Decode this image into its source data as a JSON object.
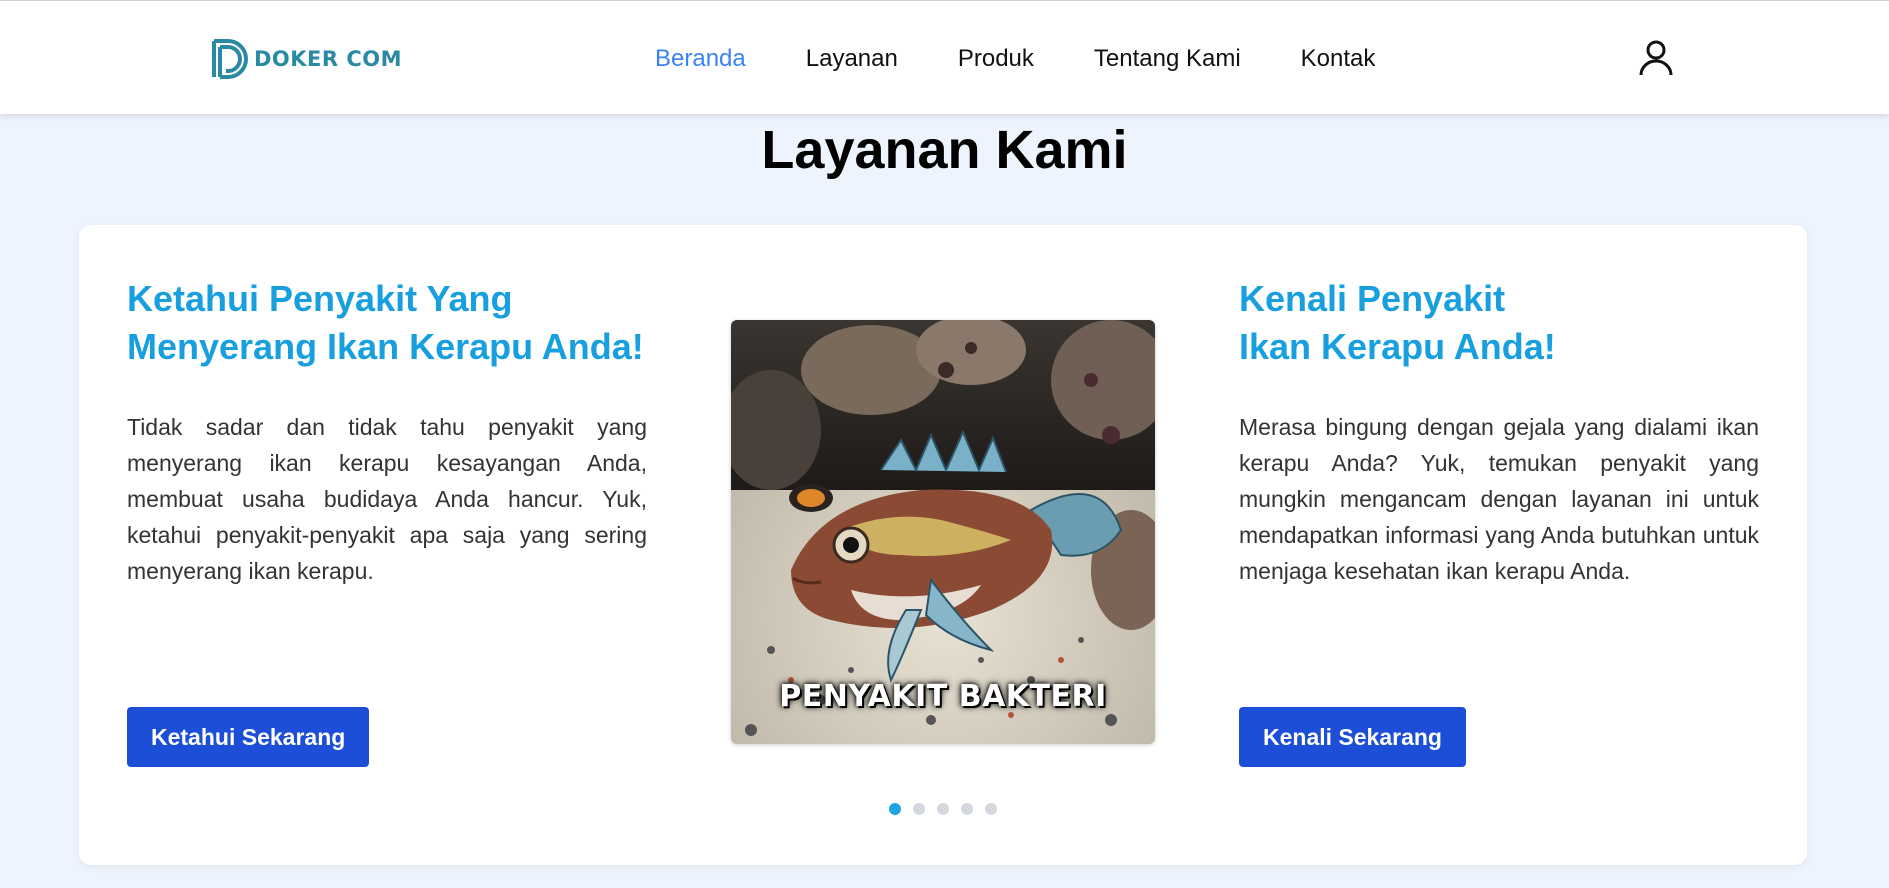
{
  "brand": {
    "name": "DOKER COM"
  },
  "nav": {
    "items": [
      {
        "label": "Beranda",
        "active": true
      },
      {
        "label": "Layanan",
        "active": false
      },
      {
        "label": "Produk",
        "active": false
      },
      {
        "label": "Tentang Kami",
        "active": false
      },
      {
        "label": "Kontak",
        "active": false
      }
    ],
    "user_icon": "user-icon"
  },
  "section": {
    "title": "Layanan Kami"
  },
  "left_panel": {
    "heading": "Ketahui Penyakit Yang\nMenyerang Ikan Kerapu Anda!",
    "body": "Tidak sadar dan tidak tahu penyakit yang menyerang ikan kerapu kesayangan Anda, membuat usaha budidaya Anda hancur. Yuk, ketahui penyakit-penyakit apa saja yang sering menyerang ikan kerapu.",
    "button_label": "Ketahui Sekarang"
  },
  "right_panel": {
    "heading": "Kenali Penyakit\nIkan Kerapu Anda!",
    "body": "Merasa bingung dengan gejala yang dialami ikan kerapu Anda? Yuk, temukan penyakit yang mungkin mengancam dengan layanan ini untuk mendapatkan informasi yang Anda butuhkan untuk menjaga kesehatan ikan kerapu Anda.",
    "button_label": "Kenali Sekarang"
  },
  "carousel": {
    "caption": "PENYAKIT BAKTERI",
    "total_slides": 5,
    "active_index": 0
  },
  "colors": {
    "accent": "#179fe0",
    "button": "#1d4ed8",
    "nav_active": "#3b82f6",
    "page_bg": "#eef4fd",
    "brand": "#2a8aa3"
  }
}
